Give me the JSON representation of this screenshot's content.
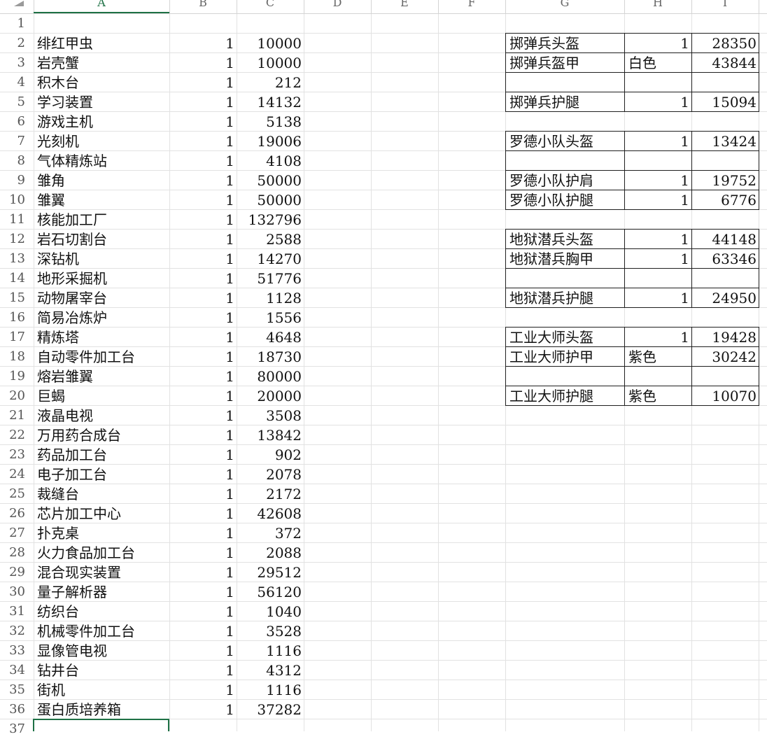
{
  "columns": [
    "A",
    "B",
    "C",
    "D",
    "E",
    "F",
    "G",
    "H",
    "I"
  ],
  "active_column": "A",
  "row_numbers": [
    "1",
    "2",
    "3",
    "4",
    "5",
    "6",
    "7",
    "8",
    "9",
    "10",
    "11",
    "12",
    "13",
    "14",
    "15",
    "16",
    "17",
    "18",
    "19",
    "20",
    "21",
    "22",
    "23",
    "24",
    "25",
    "26",
    "27",
    "28",
    "29",
    "30",
    "31",
    "32",
    "33",
    "34",
    "35",
    "36",
    "37"
  ],
  "left_table": [
    {
      "name": "绯红甲虫",
      "qty": "1",
      "value": "10000"
    },
    {
      "name": "岩壳蟹",
      "qty": "1",
      "value": "10000"
    },
    {
      "name": "积木台",
      "qty": "1",
      "value": "212"
    },
    {
      "name": "学习装置",
      "qty": "1",
      "value": "14132"
    },
    {
      "name": "游戏主机",
      "qty": "1",
      "value": "5138"
    },
    {
      "name": "光刻机",
      "qty": "1",
      "value": "19006"
    },
    {
      "name": "气体精炼站",
      "qty": "1",
      "value": "4108"
    },
    {
      "name": "雏角",
      "qty": "1",
      "value": "50000"
    },
    {
      "name": "雏翼",
      "qty": "1",
      "value": "50000"
    },
    {
      "name": "核能加工厂",
      "qty": "1",
      "value": "132796"
    },
    {
      "name": "岩石切割台",
      "qty": "1",
      "value": "2588"
    },
    {
      "name": "深钻机",
      "qty": "1",
      "value": "14270"
    },
    {
      "name": "地形采掘机",
      "qty": "1",
      "value": "51776"
    },
    {
      "name": "动物屠宰台",
      "qty": "1",
      "value": "1128"
    },
    {
      "name": "简易冶炼炉",
      "qty": "1",
      "value": "1556"
    },
    {
      "name": "精炼塔",
      "qty": "1",
      "value": "4648"
    },
    {
      "name": "自动零件加工台",
      "qty": "1",
      "value": "18730"
    },
    {
      "name": "熔岩雏翼",
      "qty": "1",
      "value": "80000"
    },
    {
      "name": "巨蝎",
      "qty": "1",
      "value": "20000"
    },
    {
      "name": "液晶电视",
      "qty": "1",
      "value": "3508"
    },
    {
      "name": "万用药合成台",
      "qty": "1",
      "value": "13842"
    },
    {
      "name": "药品加工台",
      "qty": "1",
      "value": "902"
    },
    {
      "name": "电子加工台",
      "qty": "1",
      "value": "2078"
    },
    {
      "name": "裁缝台",
      "qty": "1",
      "value": "2172"
    },
    {
      "name": "芯片加工中心",
      "qty": "1",
      "value": "42608"
    },
    {
      "name": "扑克桌",
      "qty": "1",
      "value": "372"
    },
    {
      "name": "火力食品加工台",
      "qty": "1",
      "value": "2088"
    },
    {
      "name": "混合现实装置",
      "qty": "1",
      "value": "29512"
    },
    {
      "name": "量子解析器",
      "qty": "1",
      "value": "56120"
    },
    {
      "name": "纺织台",
      "qty": "1",
      "value": "1040"
    },
    {
      "name": "机械零件加工台",
      "qty": "1",
      "value": "3528"
    },
    {
      "name": "显像管电视",
      "qty": "1",
      "value": "1116"
    },
    {
      "name": "钻井台",
      "qty": "1",
      "value": "4312"
    },
    {
      "name": "街机",
      "qty": "1",
      "value": "1116"
    },
    {
      "name": "蛋白质培养箱",
      "qty": "1",
      "value": "37282"
    }
  ],
  "right_table": [
    {
      "row": 2,
      "g": "掷弹兵头盔",
      "h": "1",
      "i": "28350"
    },
    {
      "row": 3,
      "g": "掷弹兵盔甲",
      "h": "白色",
      "i": "43844"
    },
    {
      "row": 4,
      "g": "",
      "h": "",
      "i": ""
    },
    {
      "row": 5,
      "g": "掷弹兵护腿",
      "h": "1",
      "i": "15094"
    },
    {
      "row": 7,
      "g": "罗德小队头盔",
      "h": "1",
      "i": "13424"
    },
    {
      "row": 8,
      "g": "",
      "h": "",
      "i": ""
    },
    {
      "row": 9,
      "g": "罗德小队护肩",
      "h": "1",
      "i": "19752"
    },
    {
      "row": 10,
      "g": "罗德小队护腿",
      "h": "1",
      "i": "6776"
    },
    {
      "row": 12,
      "g": "地狱潜兵头盔",
      "h": "1",
      "i": "44148"
    },
    {
      "row": 13,
      "g": "地狱潜兵胸甲",
      "h": "1",
      "i": "63346"
    },
    {
      "row": 14,
      "g": "",
      "h": "",
      "i": ""
    },
    {
      "row": 15,
      "g": "地狱潜兵护腿",
      "h": "1",
      "i": "24950"
    },
    {
      "row": 17,
      "g": "工业大师头盔",
      "h": "1",
      "i": "19428"
    },
    {
      "row": 18,
      "g": "工业大师护甲",
      "h": "紫色",
      "i": "30242"
    },
    {
      "row": 19,
      "g": "",
      "h": "",
      "i": ""
    },
    {
      "row": 20,
      "g": "工业大师护腿",
      "h": "紫色",
      "i": "10070"
    }
  ],
  "colors": {
    "selection": "#1e7145",
    "gridline": "#e2e2e2",
    "border": "#1f1f1f"
  }
}
